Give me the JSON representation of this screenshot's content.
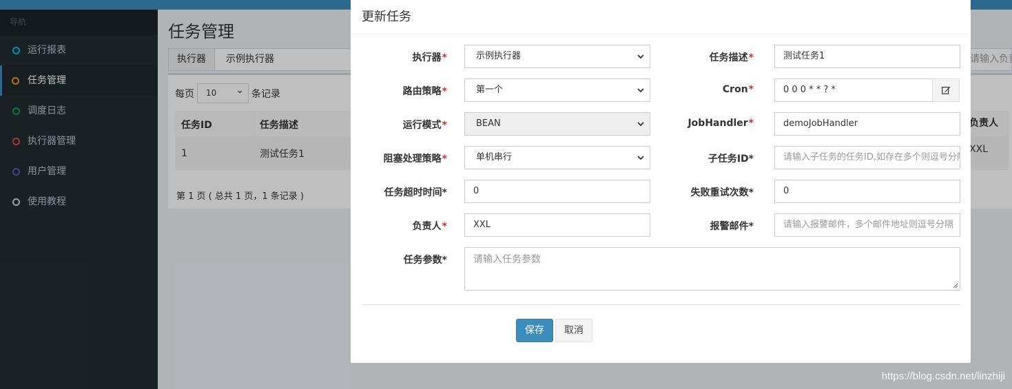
{
  "sidebar": {
    "header": "导航",
    "items": [
      {
        "label": "运行报表",
        "color": "#00c0ef"
      },
      {
        "label": "任务管理",
        "color": "#f39c12"
      },
      {
        "label": "调度日志",
        "color": "#00a65a"
      },
      {
        "label": "执行器管理",
        "color": "#dd4b39"
      },
      {
        "label": "用户管理",
        "color": "#605ca8"
      },
      {
        "label": "使用教程",
        "color": "#d2d6de"
      }
    ]
  },
  "page": {
    "title": "任务管理",
    "executor_label": "执行器",
    "executor_value": "示例执行器",
    "owner_filter_placeholder": "请输入负责人",
    "per_page_prefix": "每页",
    "per_page_value": "10",
    "per_page_suffix": "条记录",
    "table": {
      "headers": [
        "任务ID",
        "任务描述"
      ],
      "header_right": "负责人",
      "row": [
        "1",
        "测试任务1"
      ],
      "row_right": "XXL"
    },
    "pager_text": "第 1 页 ( 总共 1 页，1 条记录 )"
  },
  "modal": {
    "title": "更新任务",
    "fields": {
      "executor": {
        "label": "执行器",
        "value": "示例执行器"
      },
      "job_desc": {
        "label": "任务描述",
        "value": "测试任务1"
      },
      "route": {
        "label": "路由策略",
        "value": "第一个"
      },
      "cron": {
        "label": "Cron",
        "value": "0 0 0 * * ? *"
      },
      "mode": {
        "label": "运行模式",
        "value": "BEAN"
      },
      "handler": {
        "label": "JobHandler",
        "value": "demoJobHandler"
      },
      "block": {
        "label": "阻塞处理策略",
        "value": "单机串行"
      },
      "child": {
        "label": "子任务ID*",
        "placeholder": "请输入子任务的任务ID,如存在多个则逗号分隔"
      },
      "timeout": {
        "label": "任务超时时间*",
        "value": "0"
      },
      "retry": {
        "label": "失败重试次数*",
        "value": "0"
      },
      "author": {
        "label": "负责人",
        "value": "XXL"
      },
      "alarm": {
        "label": "报警邮件*",
        "placeholder": "请输入报警邮件，多个邮件地址则逗号分隔"
      },
      "param": {
        "label": "任务参数*",
        "placeholder": "请输入任务参数"
      }
    },
    "required_mark": "*",
    "save_label": "保存",
    "cancel_label": "取消"
  },
  "watermark": "https://blog.csdn.net/linzhiji"
}
